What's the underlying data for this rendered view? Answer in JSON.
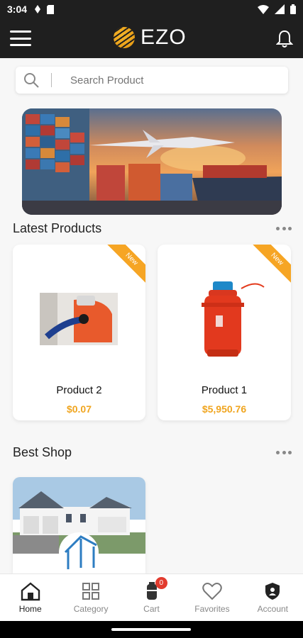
{
  "status_bar": {
    "time": "3:04"
  },
  "app_bar": {
    "brand": "EZO"
  },
  "search": {
    "placeholder": "Search Product"
  },
  "sections": {
    "latest_title": "Latest Products",
    "best_shop_title": "Best Shop"
  },
  "products": [
    {
      "name": "Product 2",
      "price": "$0.07",
      "badge": "New"
    },
    {
      "name": "Product 1",
      "price": "$5,950.76",
      "badge": "New"
    }
  ],
  "bottom_nav": {
    "items": [
      {
        "label": "Home",
        "icon": "home-icon"
      },
      {
        "label": "Category",
        "icon": "grid-icon"
      },
      {
        "label": "Cart",
        "icon": "cart-icon",
        "badge": "0"
      },
      {
        "label": "Favorites",
        "icon": "heart-icon"
      },
      {
        "label": "Account",
        "icon": "shield-user-icon"
      }
    ]
  },
  "colors": {
    "accent": "#f0a51f",
    "badge": "#e23b2e",
    "header": "#1f1f1f"
  }
}
